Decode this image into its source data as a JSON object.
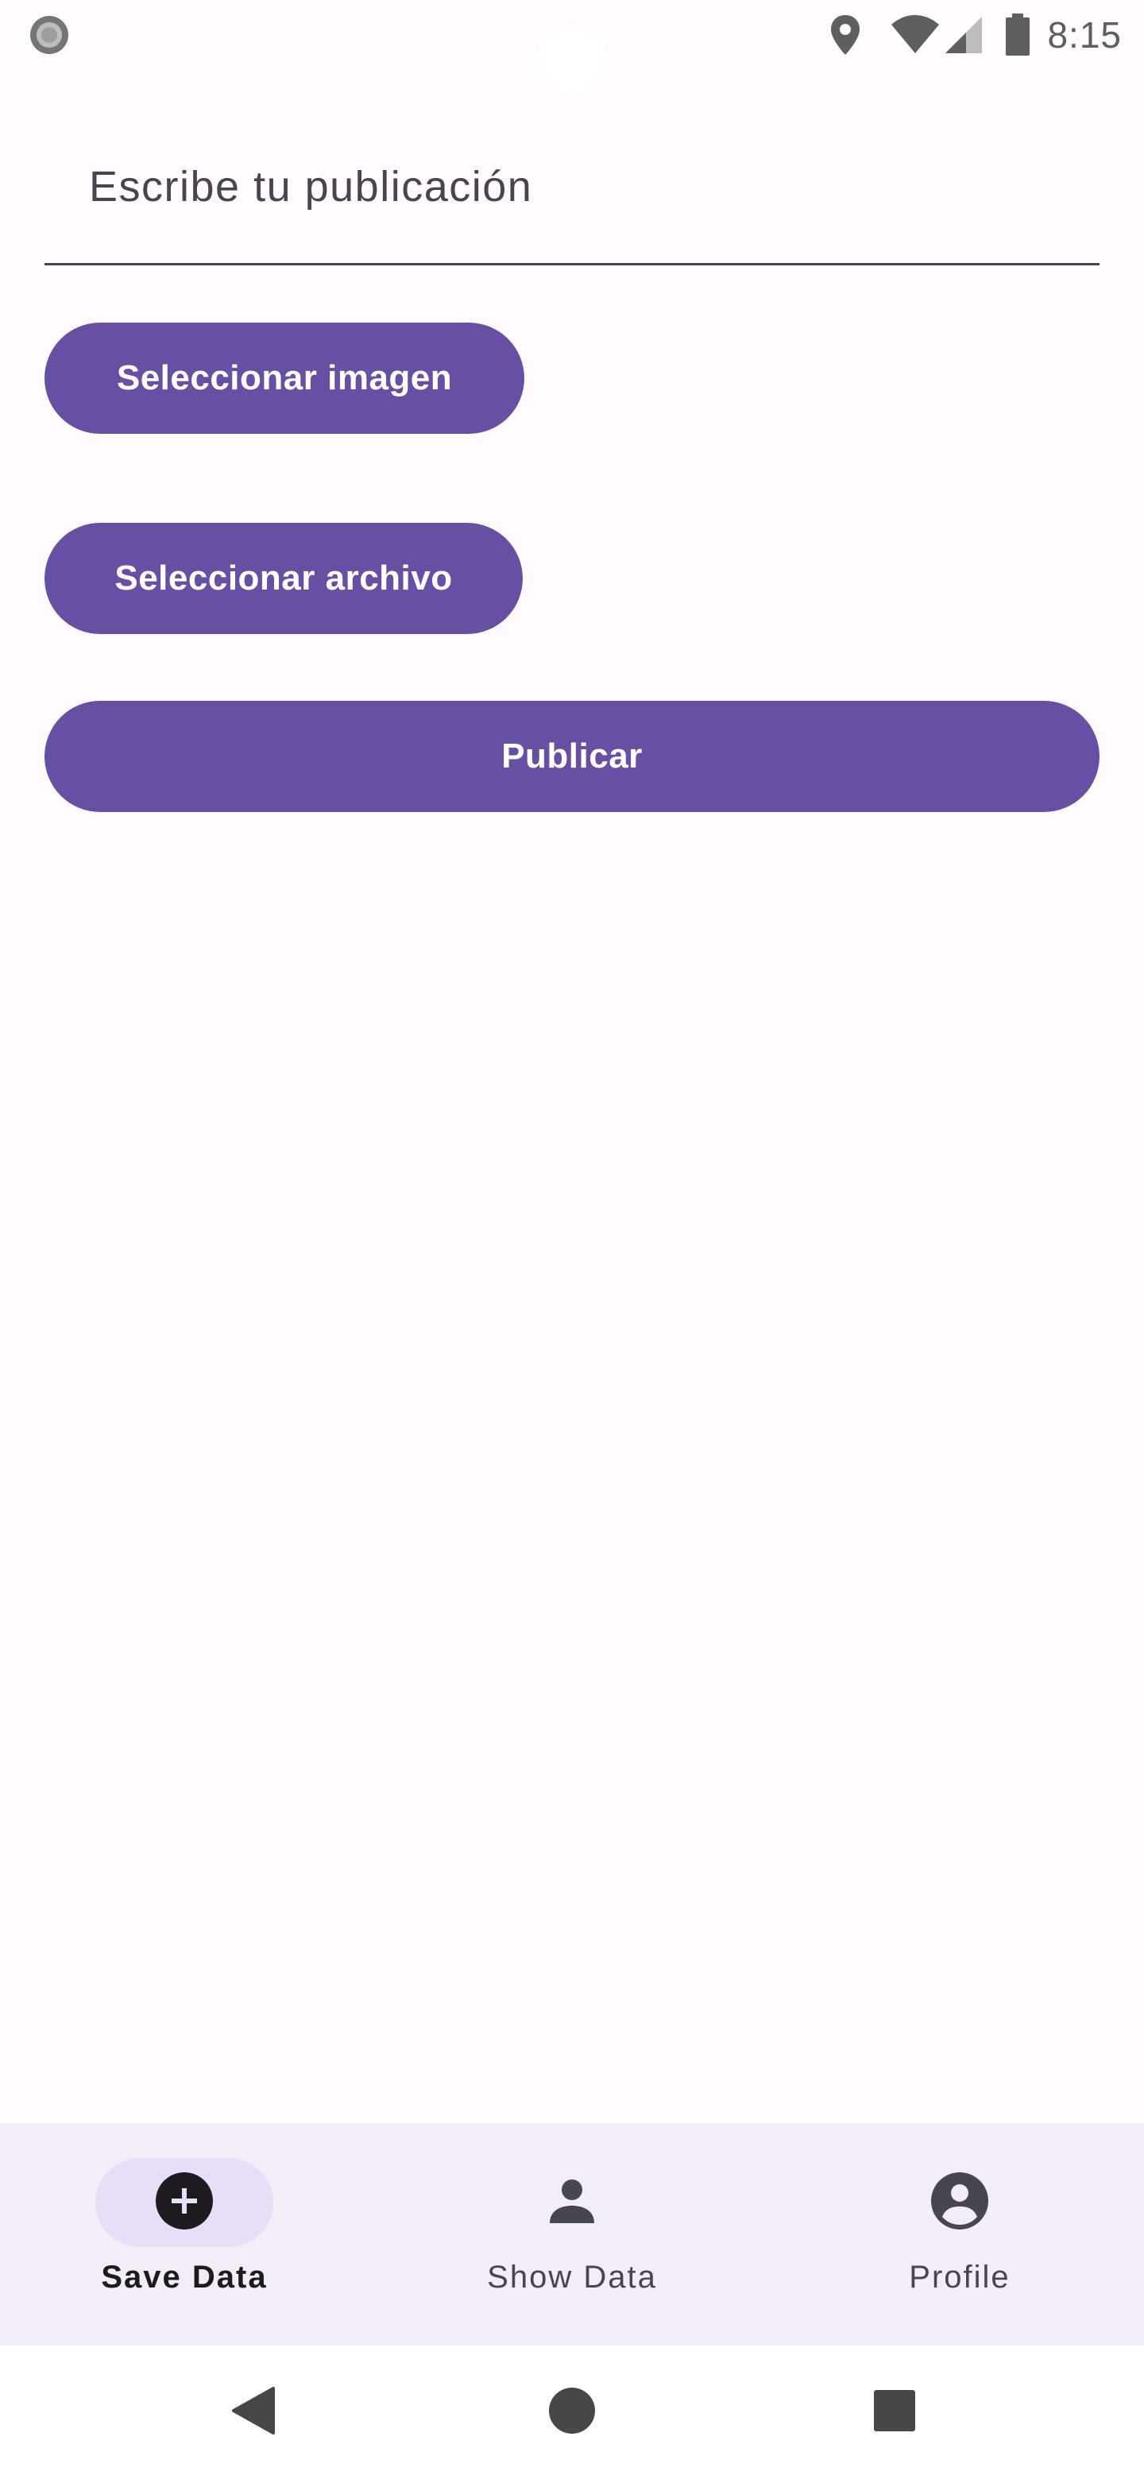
{
  "status_bar": {
    "time": "8:15",
    "icons": [
      "record-icon",
      "location-icon",
      "wifi-icon",
      "signal-icon",
      "battery-icon"
    ]
  },
  "post_form": {
    "text_field": {
      "placeholder": "Escribe tu publicación",
      "value": ""
    },
    "select_image_label": "Seleccionar imagen",
    "select_file_label": "Seleccionar archivo",
    "publish_label": "Publicar"
  },
  "bottom_nav": {
    "items": [
      {
        "label": "Save Data",
        "icon": "add-circle-icon",
        "active": true
      },
      {
        "label": "Show Data",
        "icon": "person-icon",
        "active": false
      },
      {
        "label": "Profile",
        "icon": "account-circle-icon",
        "active": false
      }
    ]
  },
  "system_nav": {
    "buttons": [
      "back-icon",
      "home-icon",
      "recents-icon"
    ]
  },
  "colors": {
    "primary": "#6750a4",
    "background": "#fffbfe",
    "nav_background": "#f3edf7",
    "nav_indicator": "#e8def8",
    "on_surface_variant": "#49454f"
  }
}
